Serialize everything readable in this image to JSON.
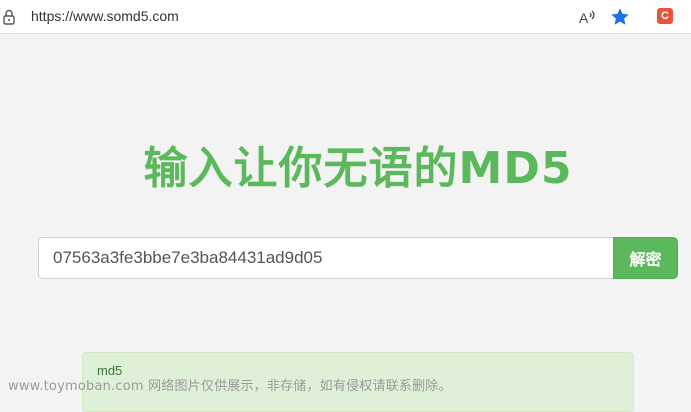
{
  "browser": {
    "url": "https://www.somd5.com",
    "icons": {
      "lock": "lock-icon",
      "read_aloud": "read-aloud-icon",
      "favorite": "star-icon",
      "extension": "extension-c-icon"
    },
    "extension_letter": "C",
    "favorite_color": "#1a73e8"
  },
  "main": {
    "title": "输入让你无语的MD5",
    "search": {
      "value": "07563a3fe3bbe7e3ba84431ad9d05",
      "placeholder": ""
    },
    "decrypt_label": "解密",
    "result": {
      "label": "md5"
    }
  },
  "watermark": {
    "text": "www.toymoban.com 网络图片仅供展示，非存储，如有侵权请联系删除。"
  },
  "colors": {
    "accent": "#5cb85c",
    "result_bg": "#dff0d8",
    "page_bg": "#f3f3f3"
  }
}
